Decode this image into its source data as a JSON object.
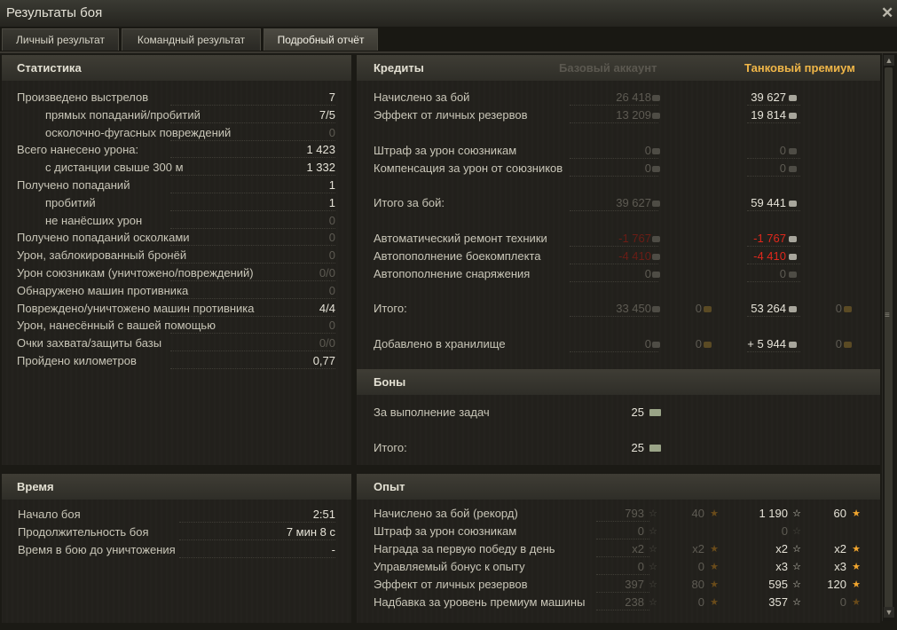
{
  "window": {
    "title": "Результаты боя",
    "close_icon": "close-icon"
  },
  "tabs": [
    {
      "label": "Личный результат"
    },
    {
      "label": "Командный результат"
    },
    {
      "label": "Подробный отчёт",
      "active": true
    }
  ],
  "stats": {
    "title": "Статистика",
    "rows": [
      {
        "label": "Произведено выстрелов",
        "value": "7",
        "dim": false
      },
      {
        "label": "прямых попаданий/пробитий",
        "value": "7/5",
        "dim": false
      },
      {
        "label": "осколочно-фугасных повреждений",
        "value": "0",
        "dim": true
      },
      {
        "label": "Всего нанесено урона:",
        "value": "1 423",
        "dim": false
      },
      {
        "label": "с дистанции свыше 300 м",
        "value": "1 332",
        "dim": false
      },
      {
        "label": "Получено попаданий",
        "value": "1",
        "dim": false
      },
      {
        "label": "пробитий",
        "value": "1",
        "dim": false
      },
      {
        "label": "не нанёсших урон",
        "value": "0",
        "dim": true
      },
      {
        "label": "Получено попаданий осколками",
        "value": "0",
        "dim": true
      },
      {
        "label": "Урон, заблокированный бронёй",
        "value": "0",
        "dim": true
      },
      {
        "label": "Урон союзникам (уничтожено/повреждений)",
        "value": "0/0",
        "dim": true
      },
      {
        "label": "Обнаружено машин противника",
        "value": "0",
        "dim": true
      },
      {
        "label": "Повреждено/уничтожено машин противника",
        "value": "4/4",
        "dim": false
      },
      {
        "label": "Урон, нанесённый с вашей помощью",
        "value": "0",
        "dim": true
      },
      {
        "label": "Очки захвата/защиты базы",
        "value": "0/0",
        "dim": true
      },
      {
        "label": "Пройдено километров",
        "value": "0,77",
        "dim": false
      }
    ]
  },
  "time": {
    "title": "Время",
    "rows": [
      {
        "label": "Начало боя",
        "value": "2:51"
      },
      {
        "label": "Продолжительность боя",
        "value": "7 мин 8 с"
      },
      {
        "label": "Время в бою до уничтожения",
        "value": "-"
      }
    ]
  },
  "credits": {
    "title": "Кредиты",
    "base_header": "Базовый аккаунт",
    "premium_header": "Танковый премиум",
    "rows": [
      {
        "label": "Начислено за бой",
        "base": "26 418",
        "prem": "39 627",
        "base_style": "dim",
        "prem_style": "normal"
      },
      {
        "label": "Эффект от личных резервов",
        "base": "13 209",
        "prem": "19 814",
        "base_style": "dim",
        "prem_style": "normal"
      },
      {
        "label": "Штраф за урон союзникам",
        "base": "0",
        "prem": "0",
        "base_style": "dim",
        "prem_style": "dim"
      },
      {
        "label": "Компенсация за урон от союзников",
        "base": "0",
        "prem": "0",
        "base_style": "dim",
        "prem_style": "dim"
      },
      {
        "label": "Итого за бой:",
        "base": "39 627",
        "prem": "59 441",
        "base_style": "dim",
        "prem_style": "normal"
      },
      {
        "label": "Автоматический ремонт техники",
        "base": "-1 767",
        "prem": "-1 767",
        "base_style": "reddim",
        "prem_style": "red"
      },
      {
        "label": "Автопополнение боекомплекта",
        "base": "-4 410",
        "prem": "-4 410",
        "base_style": "reddim",
        "prem_style": "red"
      },
      {
        "label": "Автопополнение снаряжения",
        "base": "0",
        "prem": "0",
        "base_style": "dim",
        "prem_style": "dim"
      },
      {
        "label": "Итого:",
        "base": "33 450",
        "base_gold": "0",
        "prem": "53 264",
        "prem_gold": "0",
        "base_style": "dim",
        "prem_style": "normal"
      },
      {
        "label": "Добавлено в хранилище",
        "base": "0",
        "base_gold": "0",
        "prem": "+ 5 944",
        "prem_gold": "0",
        "base_style": "dim",
        "prem_style": "normal"
      }
    ]
  },
  "bonds": {
    "title": "Боны",
    "rows": [
      {
        "label": "За выполнение задач",
        "value": "25"
      },
      {
        "label": "Итого:",
        "value": "25"
      }
    ]
  },
  "xp": {
    "title": "Опыт",
    "rows": [
      {
        "label": "Начислено за бой",
        "label_extra": "(рекорд)",
        "b1": "793",
        "b2": "40",
        "p1": "1 190",
        "p2": "60"
      },
      {
        "label": "Штраф за урон союзникам",
        "b1": "0",
        "b2": "",
        "p1": "0",
        "p2": ""
      },
      {
        "label": "Награда за первую победу в день",
        "b1": "x2",
        "b2": "x2",
        "p1": "x2",
        "p2": "x2"
      },
      {
        "label": "Управляемый бонус к опыту",
        "b1": "0",
        "b2": "0",
        "p1": "x3",
        "p2": "x3"
      },
      {
        "label": "Эффект от личных резервов",
        "b1": "397",
        "b2": "80",
        "p1": "595",
        "p2": "120"
      },
      {
        "label": "Надбавка за уровень премиум машины",
        "b1": "238",
        "b2": "0",
        "p1": "357",
        "p2": "0"
      }
    ]
  },
  "icons": {
    "credit": "credit-coin-icon",
    "gold": "gold-coin-icon",
    "xp": "xp-star-icon",
    "free_xp": "free-xp-star-icon",
    "bond": "bond-icon"
  },
  "colors": {
    "premium_header": "#f0b648",
    "negative": "#e0281c",
    "dim": "#5e5b53"
  }
}
